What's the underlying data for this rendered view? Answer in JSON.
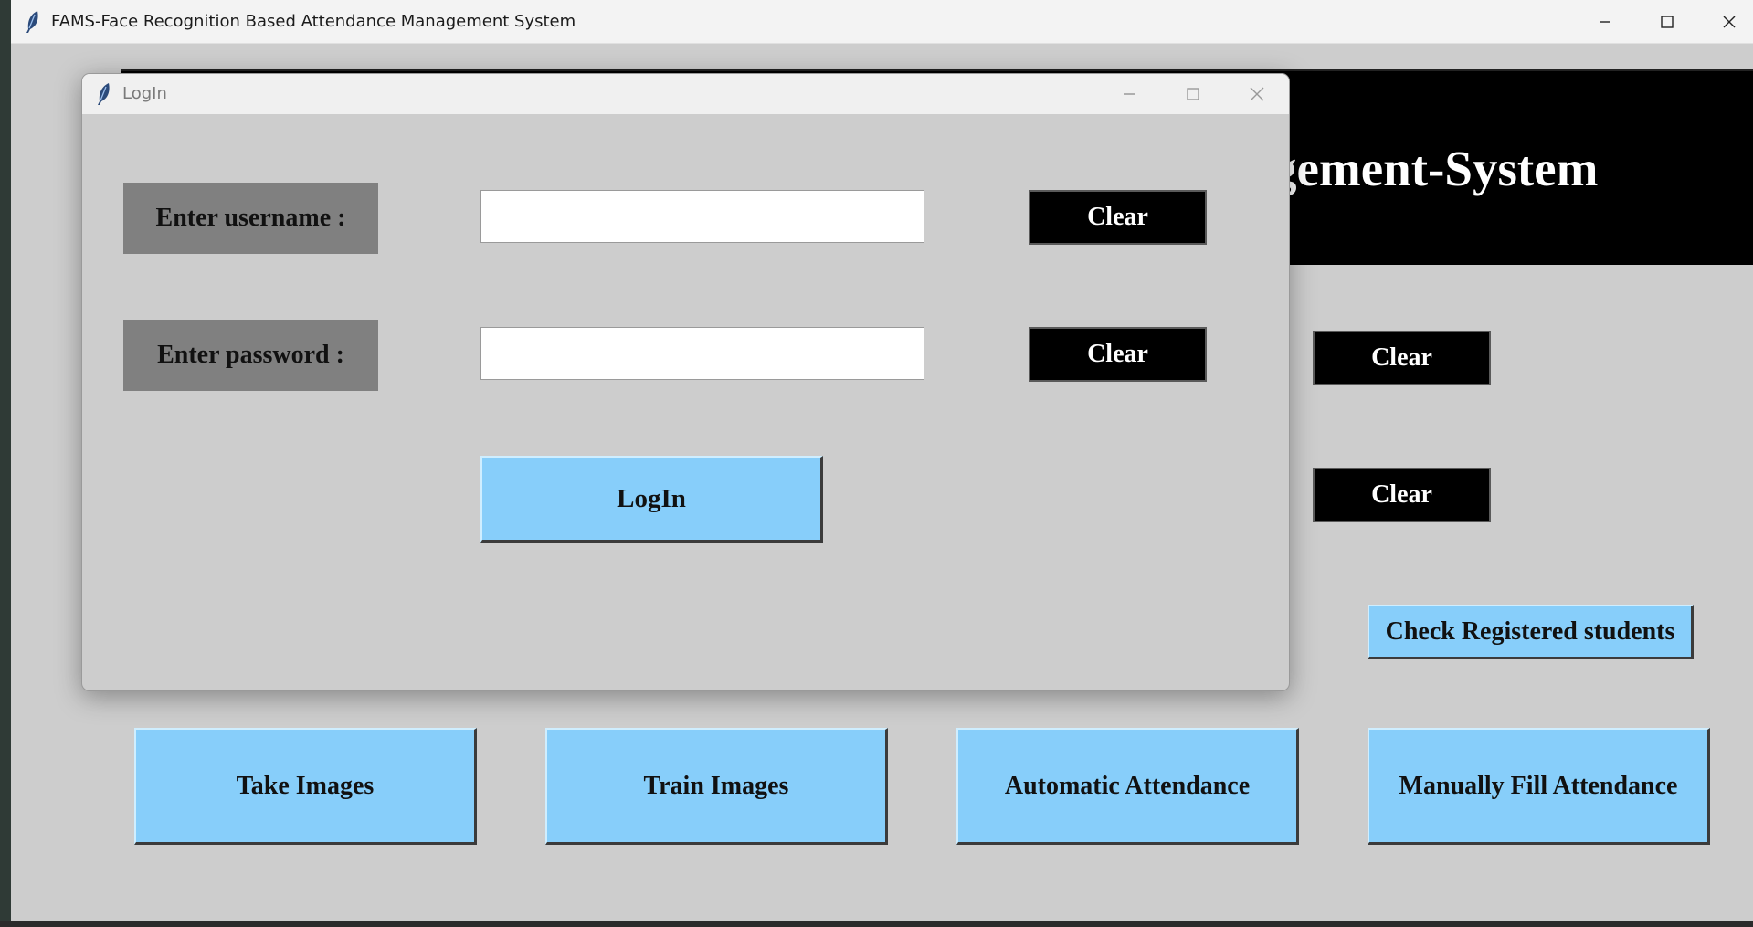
{
  "main_window": {
    "title": "FAMS-Face Recognition Based Attendance Management System",
    "banner_text": "gement-System",
    "clear_buttons": [
      "Clear",
      "Clear"
    ],
    "check_registered_label": "Check Registered students",
    "actions": {
      "take_images": "Take Images",
      "train_images": "Train Images",
      "automatic_attendance": "Automatic Attendance",
      "manual_attendance": "Manually Fill Attendance"
    }
  },
  "login_dialog": {
    "title": "LogIn",
    "username_label": "Enter username :",
    "password_label": "Enter password :",
    "username_value": "",
    "password_value": "",
    "clear_username_label": "Clear",
    "clear_password_label": "Clear",
    "login_button_label": "LogIn"
  },
  "colors": {
    "window_bg": "#cdcdcd",
    "button_blue": "#87cefa",
    "label_gray": "#808080",
    "banner_black": "#000000"
  },
  "icons": [
    "feather-icon",
    "minimize-icon",
    "maximize-icon",
    "close-icon"
  ]
}
